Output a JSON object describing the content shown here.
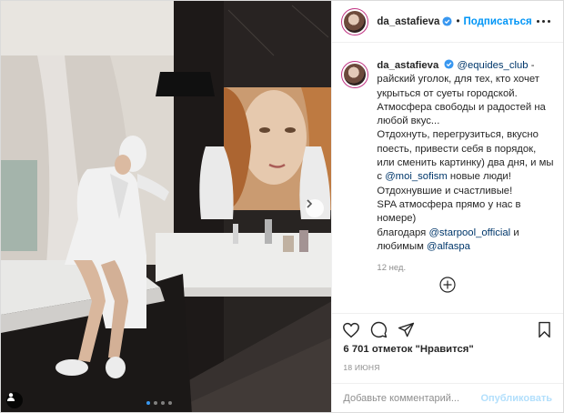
{
  "header": {
    "username": "da_astafieva",
    "separator": "•",
    "follow_label": "Подписаться"
  },
  "caption": {
    "username": "da_astafieva",
    "lines": [
      {
        "mention": "@equides_club",
        "text": " -"
      },
      {
        "text": "райский уголок, для тех, кто хочет"
      },
      {
        "text": "укрыться от суеты городской."
      },
      {
        "text": "Атмосфера свободы и радостей на"
      },
      {
        "text": "любой вкус..."
      },
      {
        "text": "Отдохнуть, перегрузиться, вкусно"
      },
      {
        "text": "поесть, привести себя в порядок,"
      },
      {
        "text": "или сменить картинку) два дня, и мы"
      },
      {
        "prefix": "с ",
        "mention": "@moi_sofism",
        "text": " новые люди!"
      },
      {
        "text": "Отдохнувшие и счастливые!"
      },
      {
        "text": "SPA атмосфера прямо у нас в"
      },
      {
        "text": "номере)"
      },
      {
        "prefix": "благодаря ",
        "mention": "@starpool_official",
        "text": " и"
      },
      {
        "prefix": "любимым ",
        "mention": "@alfaspa",
        "text": ""
      }
    ],
    "time_ago": "12 нед."
  },
  "icons": {
    "verified": "verified-badge-icon",
    "add": "plus-circle-icon",
    "like": "heart-icon",
    "comment": "comment-icon",
    "share": "share-icon",
    "save": "bookmark-icon",
    "carousel_next": "chevron-right-icon",
    "user_tag": "user-tag-icon"
  },
  "stats": {
    "likes": "6 701 отметок \"Нравится\"",
    "date": "18 ИЮНЯ"
  },
  "comment_box": {
    "placeholder": "Добавьте комментарий...",
    "publish_label": "Опубликовать"
  },
  "carousel": {
    "count": 4,
    "active": 0
  },
  "colors": {
    "link": "#00376b",
    "follow": "#0095f6",
    "publish_disabled": "#b2dffc",
    "secondary_text": "#8e8e8e",
    "verified": "#3897f0"
  }
}
